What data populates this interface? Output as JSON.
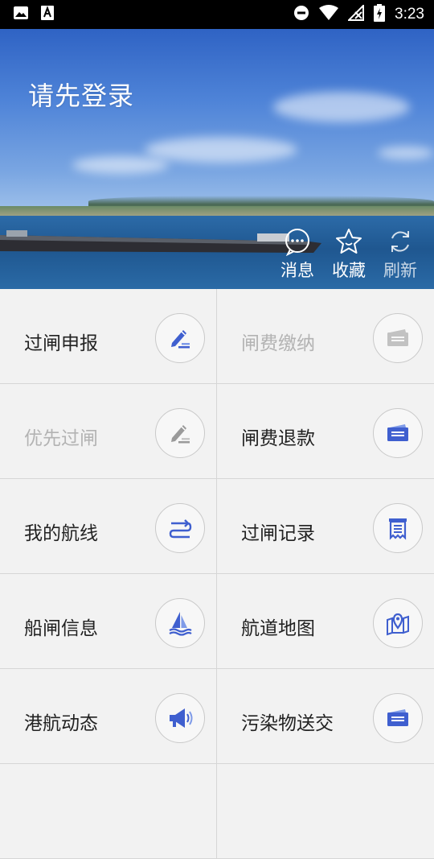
{
  "status_bar": {
    "time": "3:23",
    "icons": [
      "image-icon",
      "font-icon",
      "do-not-disturb-icon",
      "wifi-icon",
      "no-signal-icon",
      "battery-charging-icon"
    ]
  },
  "header": {
    "login_prompt": "请先登录",
    "actions": [
      {
        "label": "消息",
        "icon": "message-icon",
        "enabled": true
      },
      {
        "label": "收藏",
        "icon": "star-icon",
        "enabled": true
      },
      {
        "label": "刷新",
        "icon": "refresh-icon",
        "enabled": false
      }
    ]
  },
  "menu": [
    {
      "label": "过闸申报",
      "icon": "edit-icon",
      "enabled": true
    },
    {
      "label": "闸费缴纳",
      "icon": "ticket-icon",
      "enabled": false
    },
    {
      "label": "优先过闸",
      "icon": "edit-icon",
      "enabled": false
    },
    {
      "label": "闸费退款",
      "icon": "ticket-icon",
      "enabled": true
    },
    {
      "label": "我的航线",
      "icon": "route-icon",
      "enabled": true
    },
    {
      "label": "过闸记录",
      "icon": "receipt-icon",
      "enabled": true
    },
    {
      "label": "船闸信息",
      "icon": "sailboat-icon",
      "enabled": true
    },
    {
      "label": "航道地图",
      "icon": "map-pin-icon",
      "enabled": true
    },
    {
      "label": "港航动态",
      "icon": "megaphone-icon",
      "enabled": true
    },
    {
      "label": "污染物送交",
      "icon": "ticket-icon",
      "enabled": true
    }
  ],
  "colors": {
    "accent": "#3f5fcf",
    "accent_light": "#7f9be8",
    "disabled": "#b3b3b3"
  }
}
